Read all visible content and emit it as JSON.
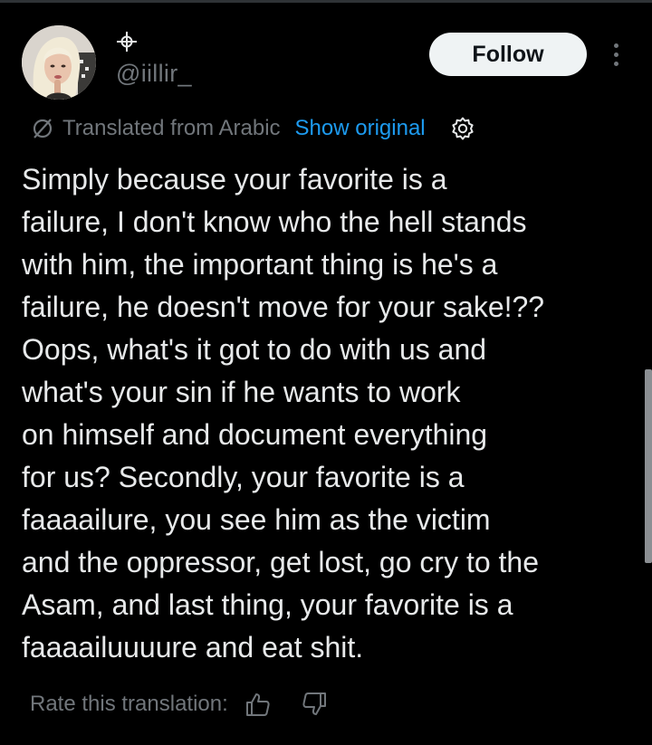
{
  "author": {
    "handle": "@iillir_",
    "handle_icon": "crosshair-icon",
    "avatar": "profile-photo"
  },
  "header": {
    "follow_label": "Follow",
    "more_icon": "more-vertical-icon"
  },
  "translation": {
    "label": "Translated from Arabic",
    "show_original": "Show original",
    "icon": "translate-slash-icon",
    "settings_icon": "gear-icon"
  },
  "tweet": {
    "lines": [
      "Simply because your favorite is a",
      "failure, I don't know who the hell stands",
      "with him, the important thing is he's a",
      "failure, he doesn't move for your sake!??",
      "Oops, what's it got to do with us and",
      "what's your sin if he wants to work",
      "on himself and document everything",
      "for us? Secondly, your favorite is a",
      "faaaailure, you see him as the victim",
      "and the oppressor, get lost, go cry to the",
      "Asam, and last thing, your favorite is a",
      "faaaailuuuure and eat shit."
    ]
  },
  "rating": {
    "label": "Rate this translation:",
    "thumbs_up_icon": "thumbs-up-icon",
    "thumbs_down_icon": "thumbs-down-icon"
  },
  "colors": {
    "background": "#000000",
    "text": "#e7e9ea",
    "muted": "#71767b",
    "link": "#1d9bf0",
    "button_bg": "#eff3f4",
    "button_text": "#0f1419"
  }
}
